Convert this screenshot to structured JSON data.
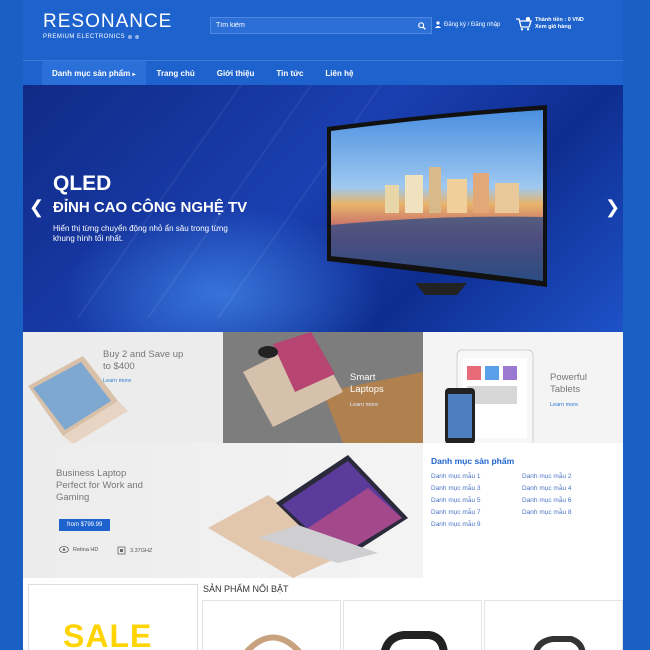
{
  "header": {
    "logo_name": "RESONANCE",
    "logo_sub": "PREMIUM ELECTRONICS",
    "search_placeholder": "Tìm kiếm",
    "login_label": "Đăng ký / Đăng nhập",
    "cart_total": "Thành tiền : 0 VND",
    "cart_view": "Xem giỏ hàng"
  },
  "nav": {
    "items": [
      "Danh mục sản phẩm",
      "Trang chủ",
      "Giới thiệu",
      "Tin tức",
      "Liên hệ"
    ],
    "caret": "▸"
  },
  "hero": {
    "title": "QLED",
    "subtitle": "ĐỈNH CAO CÔNG NGHỆ TV",
    "description": "Hiển thị từng chuyển động nhỏ ẩn sâu trong từng khung hình tối nhất.",
    "prev": "❮",
    "next": "❯"
  },
  "promos": [
    {
      "title": "Buy 2 and Save up to $400",
      "more": "Learn more"
    },
    {
      "title": "Smart Laptops",
      "more": "Learn more"
    },
    {
      "title": "Powerful Tablets",
      "more": "Learn more"
    }
  ],
  "business": {
    "title": "Business Laptop Perfect for Work and Gaming",
    "price": "from $799.99",
    "feature1": "Retina HD",
    "feature2": "3.37GHZ"
  },
  "categories": {
    "title": "Danh mục sản phẩm",
    "left": [
      "Danh mục mẫu 1",
      "Danh mục mẫu 3",
      "Danh mục mẫu 5",
      "Danh mục mẫu 7",
      "Danh mục mẫu 9"
    ],
    "right": [
      "Danh mục mẫu 2",
      "Danh mục mẫu 4",
      "Danh mục mẫu 6",
      "Danh mục mẫu 8"
    ]
  },
  "featured_title": "SẢN PHẨM NỔI BẬT",
  "sale_text": "SALE",
  "colors": {
    "brand_blue": "#1e63cd",
    "page_bg": "#1a5fc4",
    "sale_yellow": "#ffd400"
  }
}
